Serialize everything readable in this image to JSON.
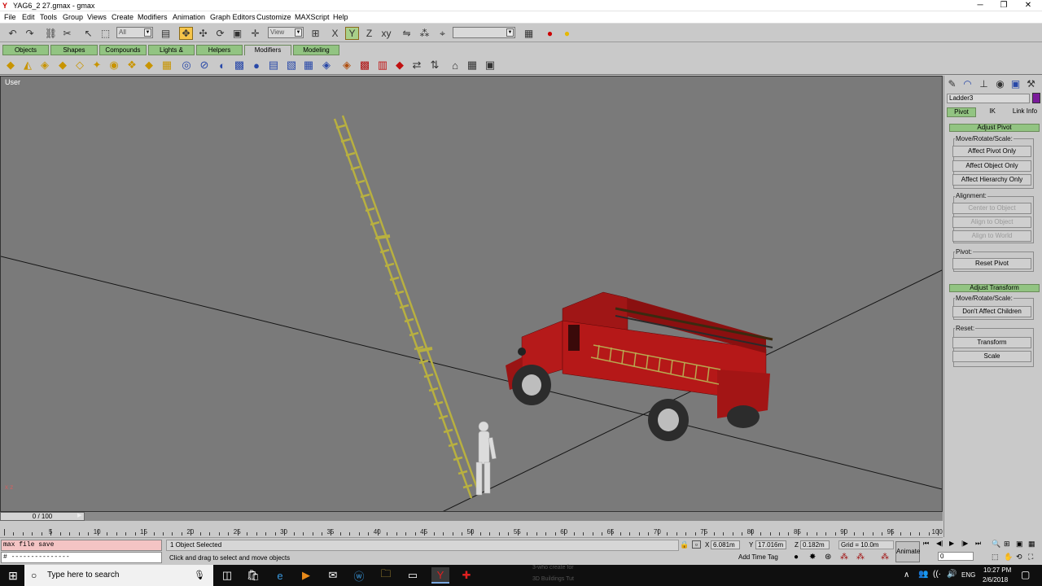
{
  "window": {
    "title": "YAG6_2 27.gmax - gmax",
    "min": "─",
    "max": "❐",
    "close": "✕"
  },
  "menu": [
    "File",
    "Edit",
    "Tools",
    "Group",
    "Views",
    "Create",
    "Modifiers",
    "Animation",
    "Graph Editors",
    "Customize",
    "MAXScript",
    "Help"
  ],
  "toolbar": {
    "selection_filter": "All",
    "ref_coord": "View",
    "named_selection": ""
  },
  "tabs": [
    "Objects",
    "Shapes",
    "Compounds",
    "Lights & Cameras",
    "Helpers",
    "Modifiers",
    "Modeling"
  ],
  "active_tab": "Modifiers",
  "viewport": {
    "label": "User",
    "bg": "#7a7a7a",
    "axis": "x  z"
  },
  "command_panel": {
    "object_name": "Ladder3",
    "object_color": "#7a1a9a",
    "sub_tabs": [
      "Pivot",
      "IK",
      "Link Info"
    ],
    "adjust_pivot": {
      "header": "Adjust Pivot",
      "move_label": "Move/Rotate/Scale:",
      "buttons": [
        "Affect Pivot Only",
        "Affect Object Only",
        "Affect Hierarchy Only"
      ],
      "alignment_label": "Alignment:",
      "alignment_buttons": [
        "Center to Object",
        "Align to Object",
        "Align to World"
      ],
      "pivot_label": "Pivot:",
      "reset_pivot": "Reset Pivot"
    },
    "adjust_transform": {
      "header": "Adjust Transform",
      "move_label": "Move/Rotate/Scale:",
      "dont_affect": "Don't Affect Children",
      "reset_label": "Reset:",
      "transform": "Transform",
      "scale": "Scale"
    }
  },
  "timeline": {
    "slider": "0 / 100",
    "ticks": [
      "5",
      "10",
      "15",
      "20",
      "25",
      "30",
      "35",
      "40",
      "45",
      "50",
      "55",
      "60",
      "65",
      "70",
      "75",
      "80",
      "85",
      "90",
      "95",
      "100"
    ]
  },
  "status": {
    "listener_line1": "max file save",
    "listener_line2": "# ---------------",
    "selected": "1 Object Selected",
    "prompt": "Click and drag to select and move objects",
    "x_label": "X",
    "x": "6.081m",
    "y_label": "Y",
    "y": "17.016m",
    "z_label": "Z",
    "z": "0.182m",
    "grid": "Grid = 10.0m",
    "add_time_tag": "Add Time Tag",
    "animate": "Animate",
    "frame": "0"
  },
  "taskbar": {
    "search_placeholder": "Type here to search",
    "tray_lang": "ENG",
    "time": "10:27 PM",
    "date": "2/6/2018",
    "preview1": "3-who create for",
    "preview2": "3D Buildings Tut"
  }
}
